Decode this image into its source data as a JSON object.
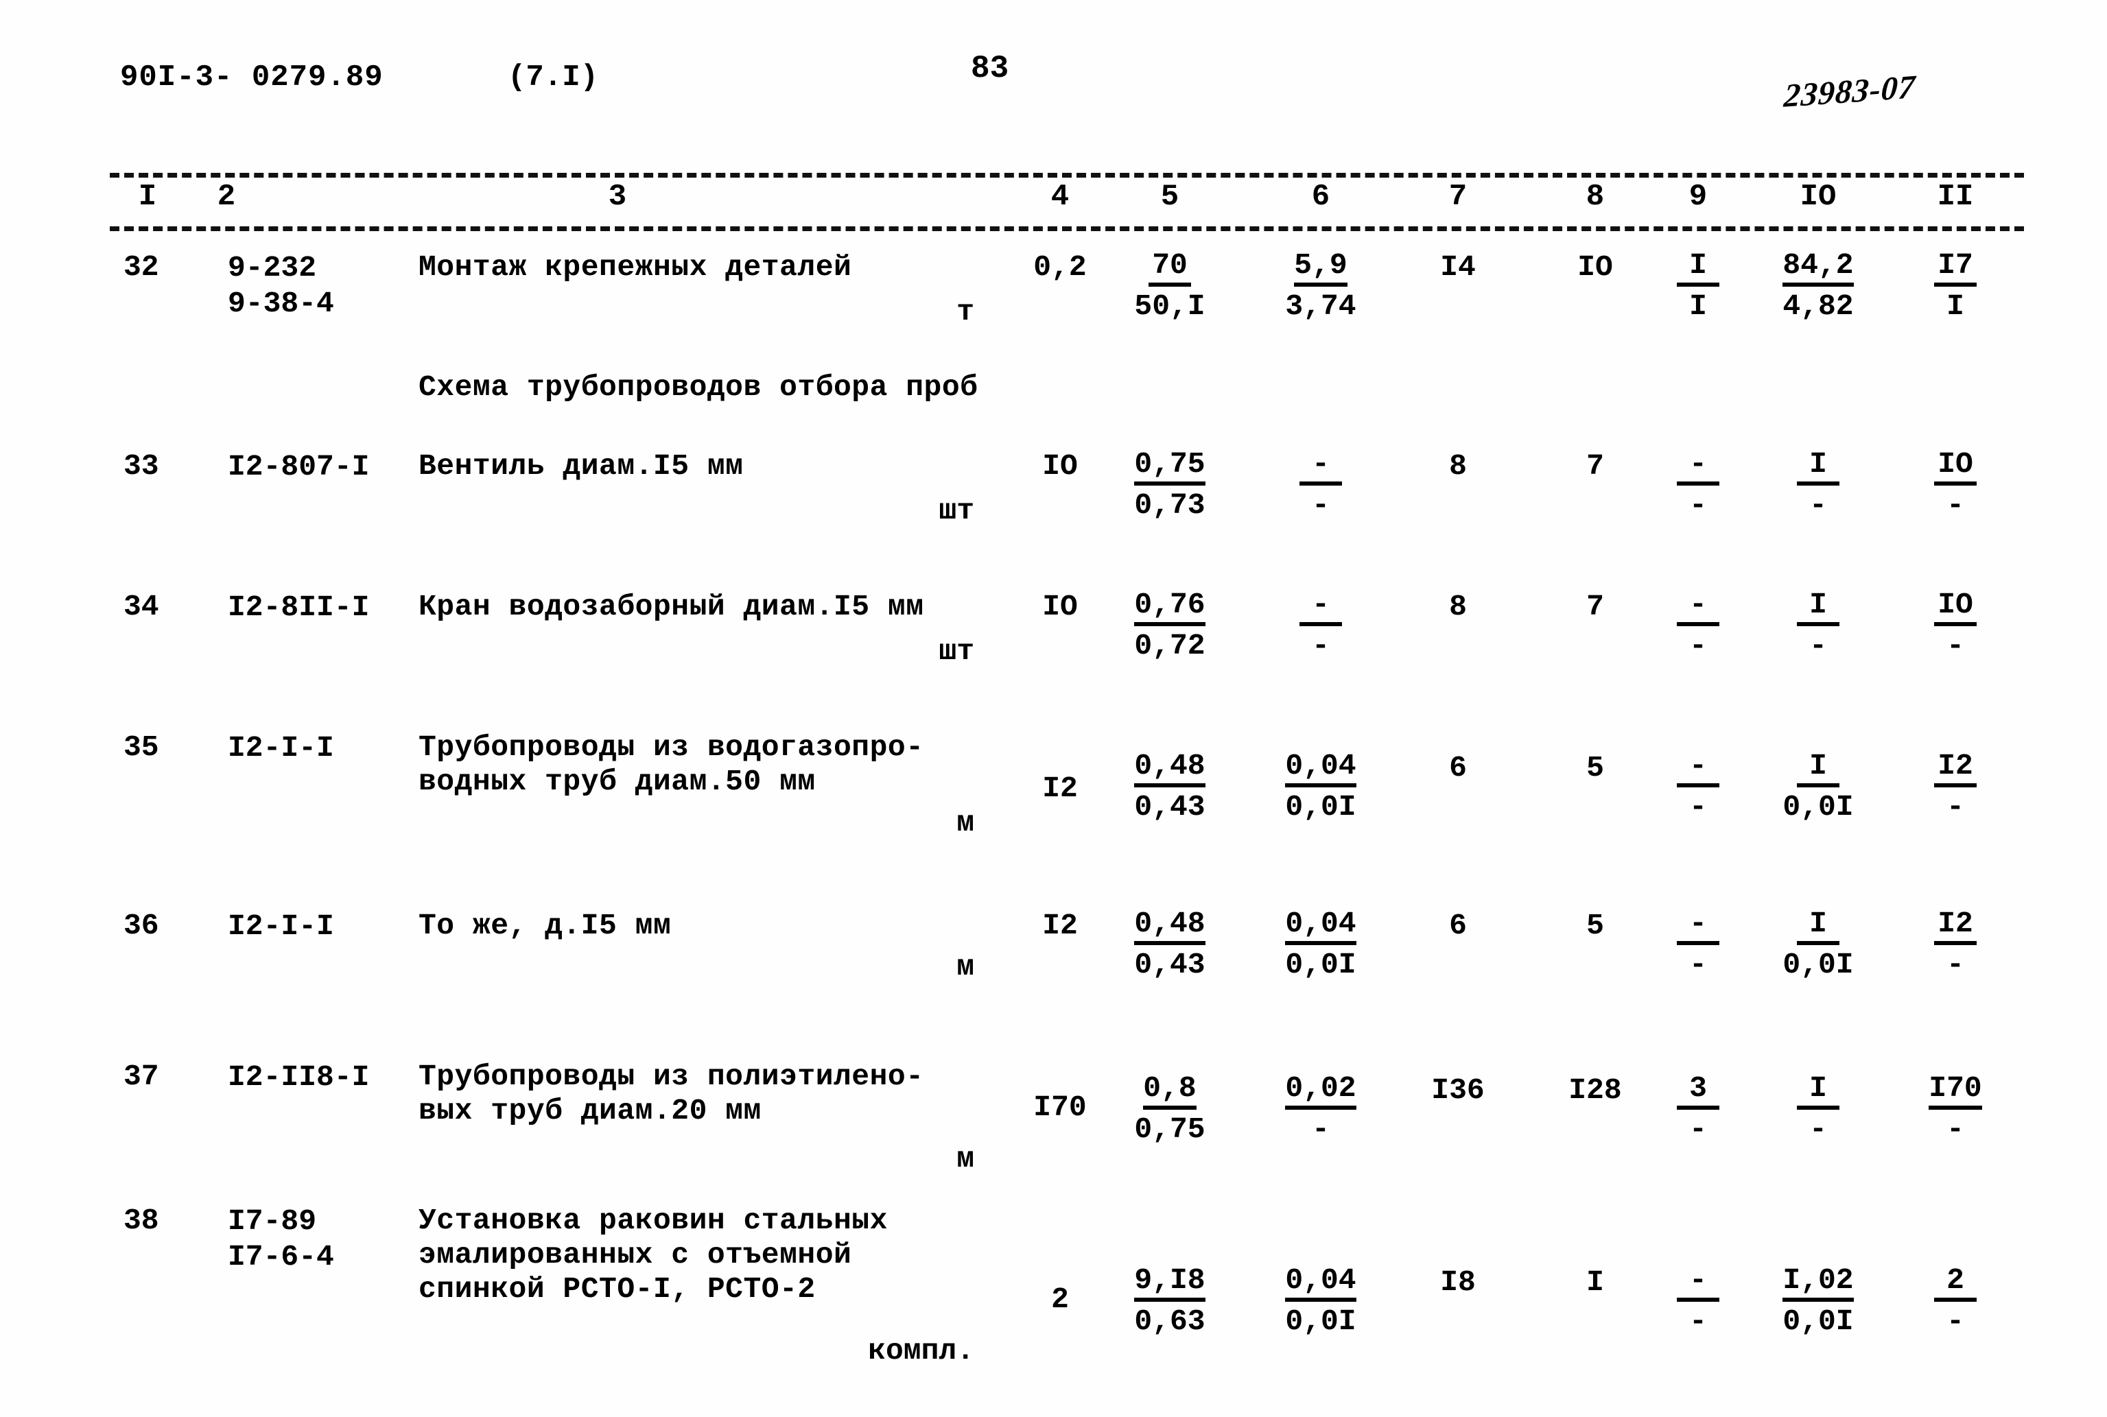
{
  "header": {
    "doc_code": "90I-3- 0279.89",
    "variant": "(7.I)",
    "page_number": "83",
    "archive_stamp": "23983-07"
  },
  "table": {
    "column_headers": [
      "I",
      "2",
      "3",
      "4",
      "5",
      "6",
      "7",
      "8",
      "9",
      "IO",
      "II"
    ],
    "section_title": "Схема трубопроводов отбора проб",
    "rows": [
      {
        "no": "32",
        "code_line1": "9-232",
        "code_line2": "9-38-4",
        "desc_line1": "Монтаж крепежных деталей",
        "desc_line2": "",
        "desc_line3": "",
        "unit": "т",
        "qty": "0,2",
        "c5_num": "70",
        "c5_den": "50,I",
        "c6_num": "5,9",
        "c6_den": "3,74",
        "c7": "I4",
        "c8": "IO",
        "c9_num": "I",
        "c9_den": "I",
        "c10_num": "84,2",
        "c10_den": "4,82",
        "c11_num": "I7",
        "c11_den": "I"
      },
      {
        "no": "33",
        "code_line1": "I2-807-I",
        "code_line2": "",
        "desc_line1": "Вентиль диам.I5 мм",
        "desc_line2": "",
        "desc_line3": "",
        "unit": "шт",
        "qty": "IO",
        "c5_num": "0,75",
        "c5_den": "0,73",
        "c6_num": "-",
        "c6_den": "-",
        "c7": "8",
        "c8": "7",
        "c9_num": "-",
        "c9_den": "-",
        "c10_num": "I",
        "c10_den": "-",
        "c11_num": "IO",
        "c11_den": "-"
      },
      {
        "no": "34",
        "code_line1": "I2-8II-I",
        "code_line2": "",
        "desc_line1": "Кран водозаборный диам.I5 мм",
        "desc_line2": "",
        "desc_line3": "",
        "unit": "шт",
        "qty": "IO",
        "c5_num": "0,76",
        "c5_den": "0,72",
        "c6_num": "-",
        "c6_den": "-",
        "c7": "8",
        "c8": "7",
        "c9_num": "-",
        "c9_den": "-",
        "c10_num": "I",
        "c10_den": "-",
        "c11_num": "IO",
        "c11_den": "-"
      },
      {
        "no": "35",
        "code_line1": "I2-I-I",
        "code_line2": "",
        "desc_line1": "Трубопроводы из водогазопро-",
        "desc_line2": "водных труб диам.50 мм",
        "desc_line3": "",
        "unit": "м",
        "qty": "I2",
        "c5_num": "0,48",
        "c5_den": "0,43",
        "c6_num": "0,04",
        "c6_den": "0,0I",
        "c7": "6",
        "c8": "5",
        "c9_num": "-",
        "c9_den": "-",
        "c10_num": "I",
        "c10_den": "0,0I",
        "c11_num": "I2",
        "c11_den": "-"
      },
      {
        "no": "36",
        "code_line1": "I2-I-I",
        "code_line2": "",
        "desc_line1": "То же, д.I5 мм",
        "desc_line2": "",
        "desc_line3": "",
        "unit": "м",
        "qty": "I2",
        "c5_num": "0,48",
        "c5_den": "0,43",
        "c6_num": "0,04",
        "c6_den": "0,0I",
        "c7": "6",
        "c8": "5",
        "c9_num": "-",
        "c9_den": "-",
        "c10_num": "I",
        "c10_den": "0,0I",
        "c11_num": "I2",
        "c11_den": "-"
      },
      {
        "no": "37",
        "code_line1": "I2-II8-I",
        "code_line2": "",
        "desc_line1": "Трубопроводы из полиэтилено-",
        "desc_line2": "вых труб диам.20 мм",
        "desc_line3": "",
        "unit": "м",
        "qty": "I70",
        "c5_num": "0,8",
        "c5_den": "0,75",
        "c6_num": "0,02",
        "c6_den": "-",
        "c7": "I36",
        "c8": "I28",
        "c9_num": "3",
        "c9_den": "-",
        "c10_num": "I",
        "c10_den": "-",
        "c11_num": "I70",
        "c11_den": "-"
      },
      {
        "no": "38",
        "code_line1": "I7-89",
        "code_line2": "I7-6-4",
        "desc_line1": "Установка раковин стальных",
        "desc_line2": "эмалированных с отъемной",
        "desc_line3": "спинкой РСТО-I, РСТО-2",
        "unit": "компл.",
        "qty": "2",
        "c5_num": "9,I8",
        "c5_den": "0,63",
        "c6_num": "0,04",
        "c6_den": "0,0I",
        "c7": "I8",
        "c8": "I",
        "c9_num": "-",
        "c9_den": "-",
        "c10_num": "I,02",
        "c10_den": "0,0I",
        "c11_num": "2",
        "c11_den": "-"
      }
    ]
  }
}
